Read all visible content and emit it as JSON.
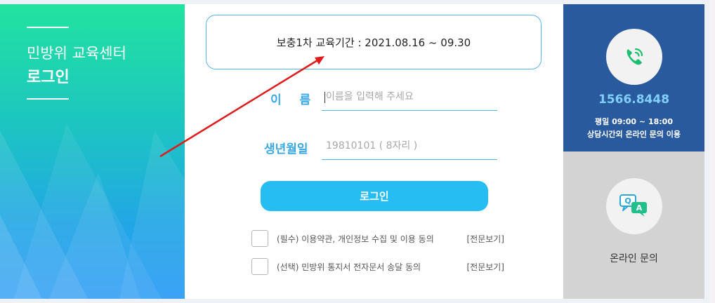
{
  "left": {
    "subtitle": "민방위 교육센터",
    "title": "로그인"
  },
  "notice": {
    "text": "보충1차 교육기간 : 2021.08.16 ~ 09.30"
  },
  "form": {
    "name_label": "이 름",
    "name_placeholder": "이름을 입력해 주세요",
    "birth_label": "생년월일",
    "birth_placeholder": "19810101 ( 8자리 )",
    "login_button": "로그인"
  },
  "agreements": [
    {
      "text": "(필수) 이용약관, 개인정보 수집 및 이용 동의",
      "link": "[전문보기]",
      "checked": false
    },
    {
      "text": "(선택) 민방위 통지서 전자문서 송달 동의",
      "link": "[전문보기]",
      "checked": false
    }
  ],
  "contact": {
    "icon": "phone-icon",
    "number": "1566.8448",
    "hours": "평일 09:00 ~ 18:00",
    "note": "상담시간외 온라인 문의 이용"
  },
  "online": {
    "icon": "qa-chat-icon",
    "label": "온라인 문의"
  },
  "colors": {
    "accent": "#25bdf2",
    "label_blue": "#3aa8e6",
    "contact_bg": "#2a5a9e",
    "online_bg": "#d3d3d3",
    "annotation_arrow": "#e01b1b"
  }
}
